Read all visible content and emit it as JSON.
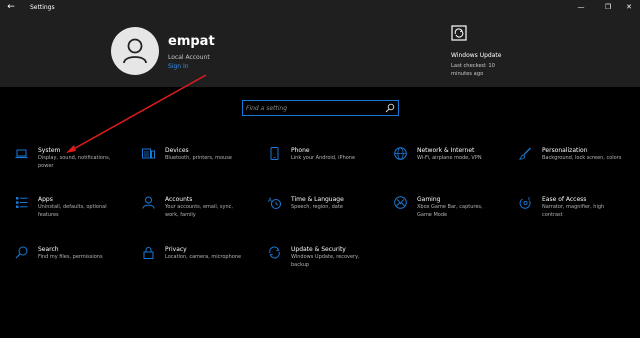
{
  "window": {
    "title": "Settings",
    "back_glyph": "←",
    "minimize_glyph": "—",
    "maximize_glyph": "❐",
    "close_glyph": "✕"
  },
  "profile": {
    "name": "empat",
    "account_type": "Local Account",
    "sign_in_label": "Sign In"
  },
  "windows_update": {
    "title": "Windows Update",
    "status": "Last checked: 10 minutes ago"
  },
  "search": {
    "placeholder": "Find a setting"
  },
  "categories": [
    {
      "icon": "laptop-icon",
      "title": "System",
      "desc": "Display, sound, notifications, power"
    },
    {
      "icon": "keyboard-devices-icon",
      "title": "Devices",
      "desc": "Bluetooth, printers, mouse"
    },
    {
      "icon": "phone-icon",
      "title": "Phone",
      "desc": "Link your Android, iPhone"
    },
    {
      "icon": "globe-icon",
      "title": "Network & Internet",
      "desc": "Wi-Fi, airplane mode, VPN"
    },
    {
      "icon": "paint-brush-icon",
      "title": "Personalization",
      "desc": "Background, lock screen, colors"
    },
    {
      "icon": "apps-list-icon",
      "title": "Apps",
      "desc": "Uninstall, defaults, optional features"
    },
    {
      "icon": "person-icon",
      "title": "Accounts",
      "desc": "Your accounts, email, sync, work, family"
    },
    {
      "icon": "time-language-icon",
      "title": "Time & Language",
      "desc": "Speech, region, date"
    },
    {
      "icon": "xbox-icon",
      "title": "Gaming",
      "desc": "Xbox Game Bar, captures, Game Mode"
    },
    {
      "icon": "ease-of-access-icon",
      "title": "Ease of Access",
      "desc": "Narrator, magnifier, high contrast"
    },
    {
      "icon": "search-icon",
      "title": "Search",
      "desc": "Find my files, permissions"
    },
    {
      "icon": "lock-icon",
      "title": "Privacy",
      "desc": "Location, camera, microphone"
    },
    {
      "icon": "sync-icon",
      "title": "Update & Security",
      "desc": "Windows Update, recovery, backup"
    }
  ],
  "colors": {
    "accent": "#1979d6",
    "background": "#000000",
    "header": "#1f1f1f",
    "annotation_arrow": "#e01b1b"
  }
}
